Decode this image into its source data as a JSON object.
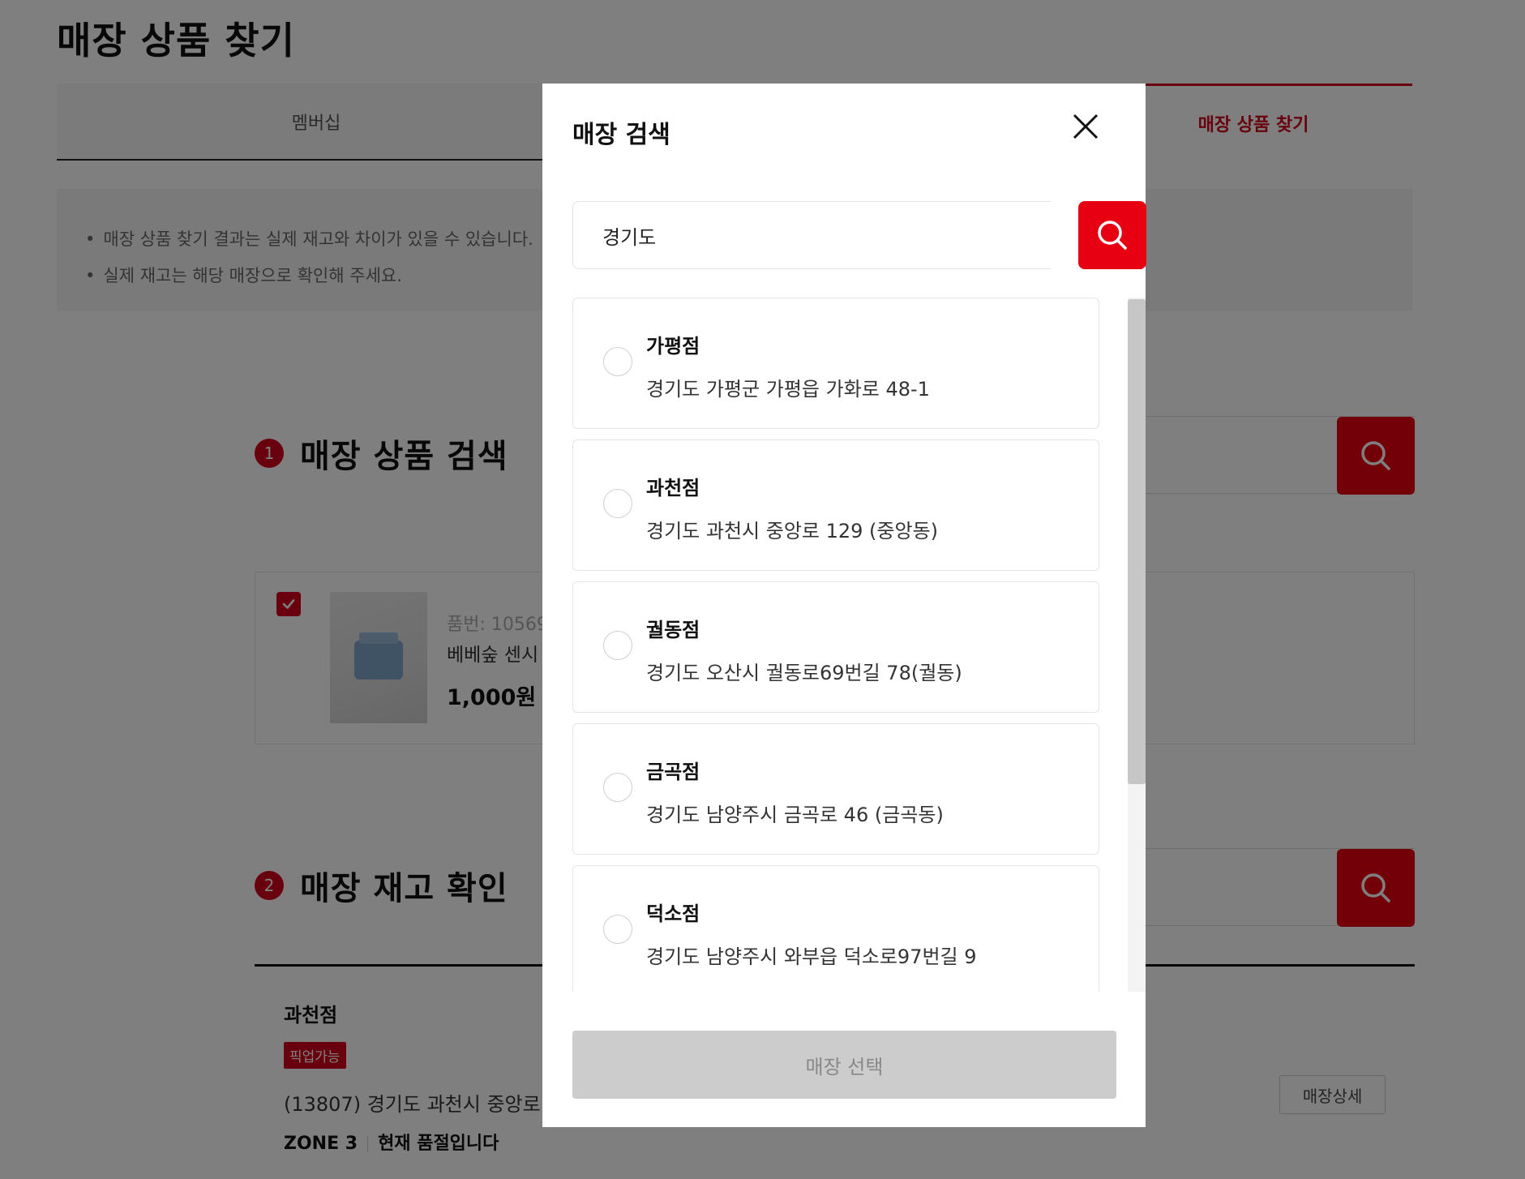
{
  "page": {
    "title": "매장 상품 찾기",
    "tabs": {
      "membership": "멤버십",
      "active": "매장 상품 찾기"
    },
    "notices": [
      "매장 상품 찾기 결과는 실제 재고와 차이가 있을 수 있습니다.",
      "실제 재고는 해당 매장으로 확인해 주세요."
    ],
    "section1": {
      "number": "1",
      "title": "매장 상품 검색"
    },
    "section2": {
      "number": "2",
      "title": "매장 재고 확인"
    },
    "product": {
      "number": "품번: 10569",
      "name": "베베숲 센시",
      "price": "1,000원"
    },
    "result": {
      "store": "과천점",
      "badge": "픽업가능",
      "address": "(13807) 경기도 과천시 중앙로",
      "zone": "ZONE 3",
      "status": "현재 품절입니다",
      "detail_button": "매장상세"
    }
  },
  "modal": {
    "title": "매장 검색",
    "search_value": "경기도",
    "stores": [
      {
        "name": "가평점",
        "address": "경기도 가평군 가평읍 가화로 48-1"
      },
      {
        "name": "과천점",
        "address": "경기도 과천시 중앙로 129 (중앙동)"
      },
      {
        "name": "궐동점",
        "address": "경기도 오산시 궐동로69번길 78(궐동)"
      },
      {
        "name": "금곡점",
        "address": "경기도 남양주시 금곡로 46 (금곡동)"
      },
      {
        "name": "덕소점",
        "address": "경기도 남양주시 와부읍 덕소로97번길 9"
      }
    ],
    "select_button": "매장 선택"
  },
  "colors": {
    "accent": "#e60012",
    "brand_red": "#d0021b",
    "overlay": "rgba(0,0,0,0.5)",
    "disabled_button": "#cccccc"
  },
  "icons": [
    "search-icon",
    "close-icon",
    "check-icon",
    "radio-unselected"
  ]
}
